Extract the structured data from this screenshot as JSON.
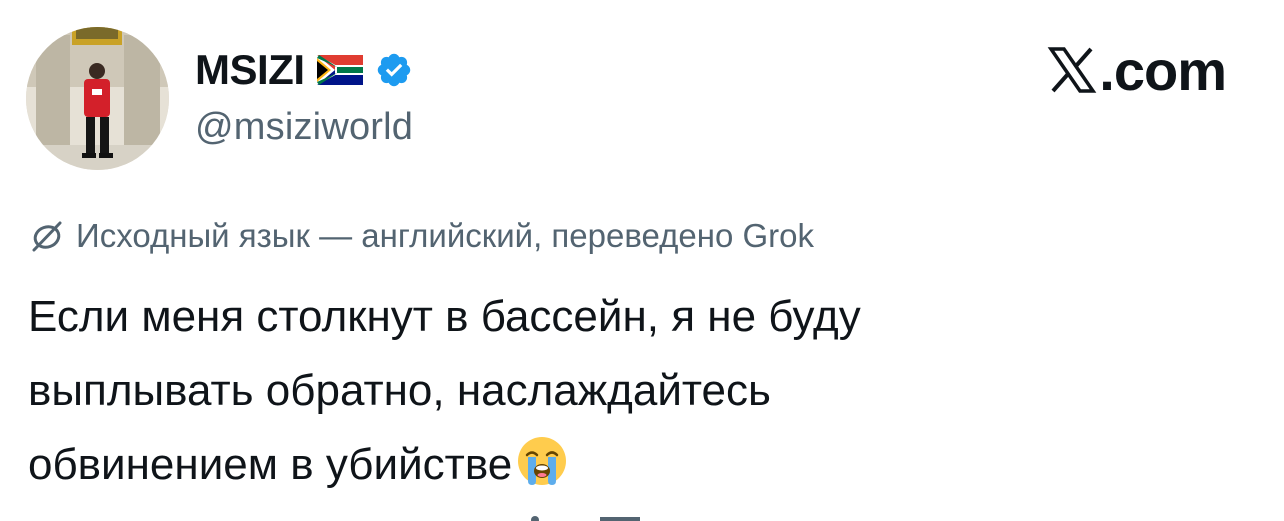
{
  "author": {
    "display_name": "MSIZI",
    "handle": "@msiziworld",
    "flag": "south-africa-flag-icon",
    "verified": "verified-badge-icon",
    "avatar": "avatar"
  },
  "brand": {
    "domain": ".com",
    "logo": "x-logo-icon"
  },
  "translation": {
    "note": "Исходный язык — английский, переведено Grok",
    "icon": "translate-icon"
  },
  "tweet": {
    "lines": [
      "Если меня столкнут в бассейн, я не буду",
      "выплывать обратно, наслаждайтесь",
      "обвинением в убийстве"
    ],
    "emoji": "loudly-crying-face-icon"
  },
  "colors": {
    "text_primary": "#0f1419",
    "text_secondary": "#536471",
    "verified_blue": "#1d9bf0",
    "background": "#ffffff"
  }
}
